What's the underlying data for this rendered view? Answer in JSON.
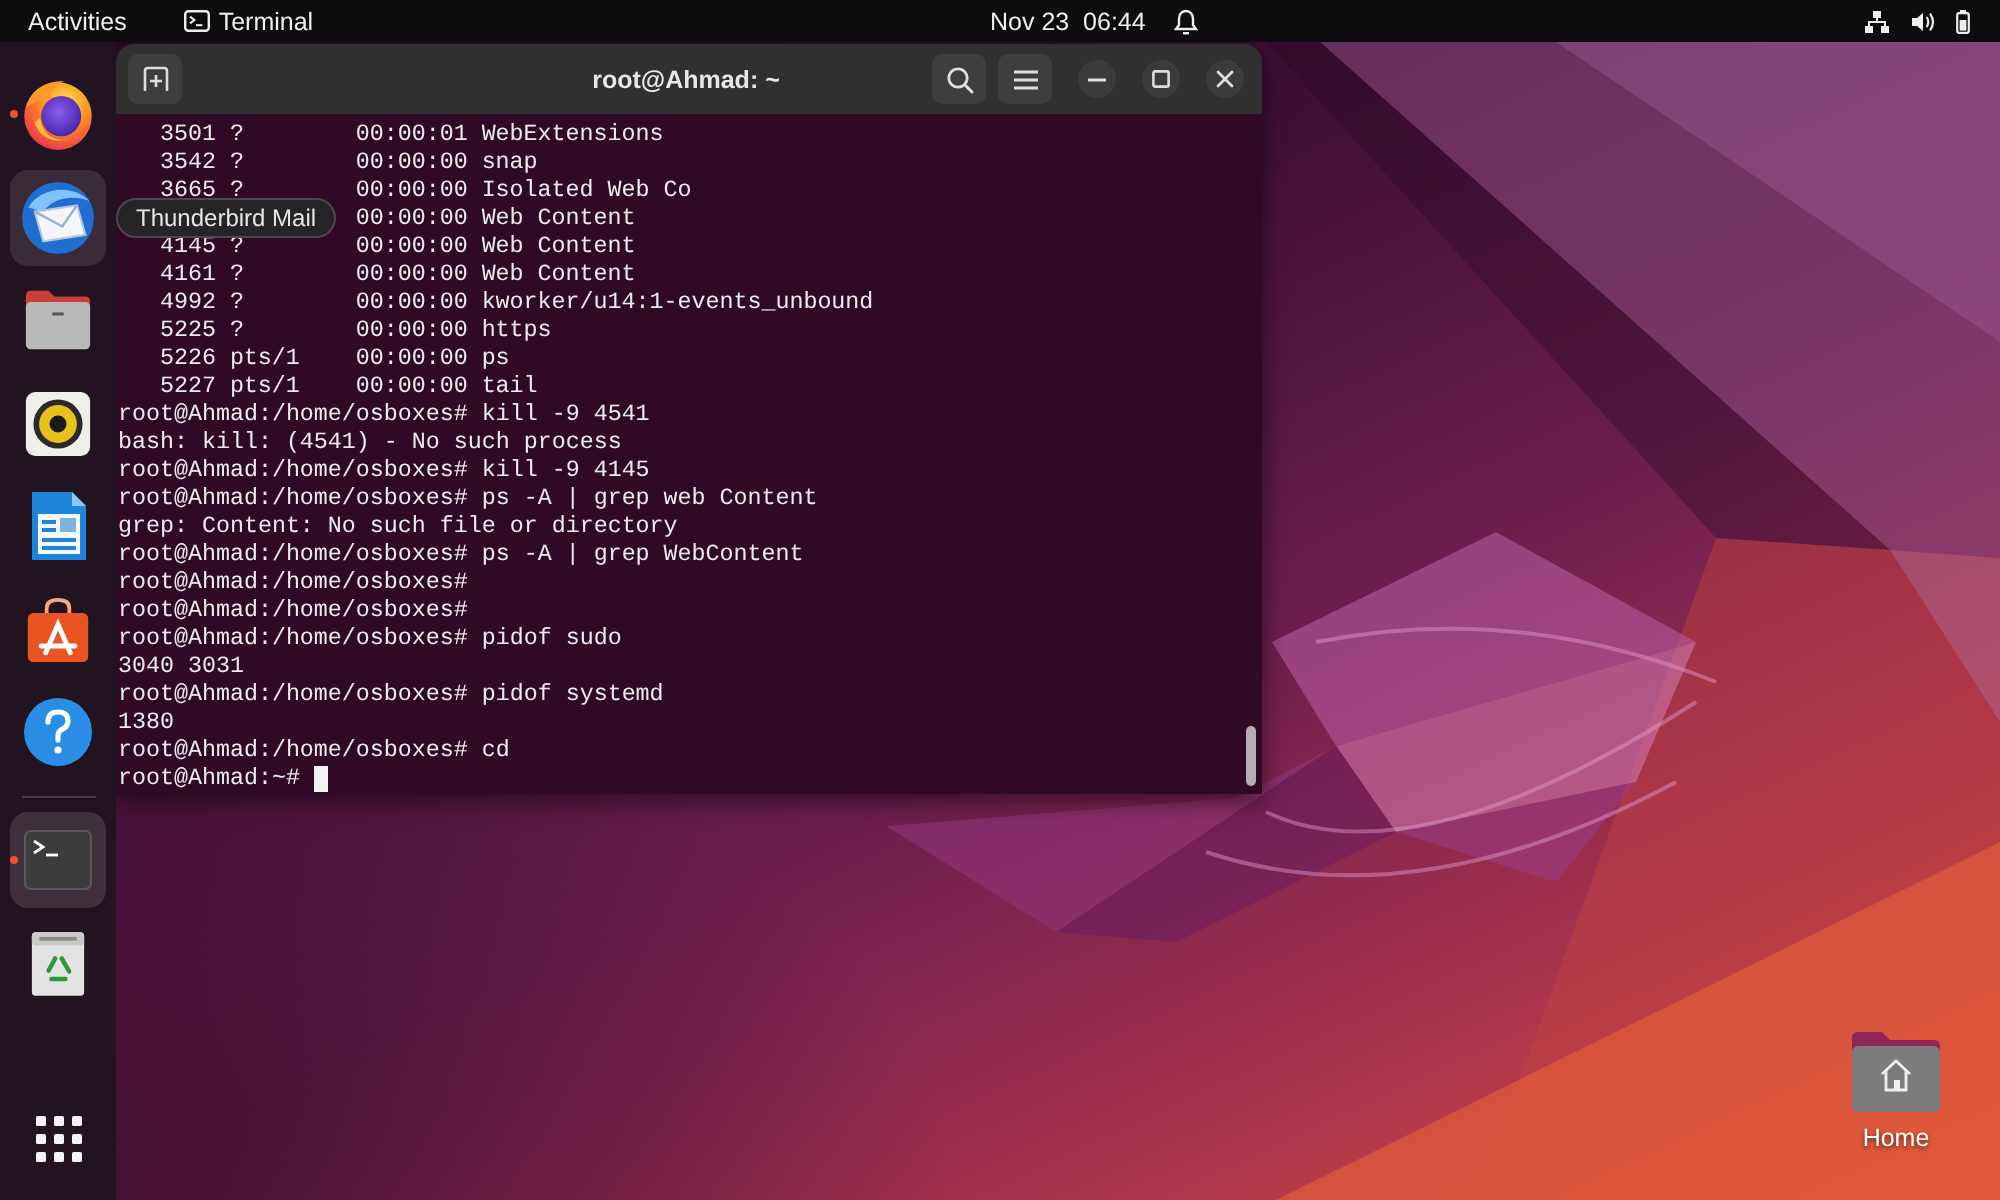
{
  "top_bar": {
    "activities": "Activities",
    "app_menu": "Terminal",
    "clock": "Nov 23  06:44"
  },
  "dock": {
    "favorites": [
      {
        "kind": "browser",
        "running": true,
        "hovered": false,
        "selected": false
      },
      {
        "kind": "mail",
        "running": false,
        "hovered": true,
        "selected": false
      },
      {
        "kind": "files",
        "running": false,
        "hovered": false,
        "selected": false
      },
      {
        "kind": "music",
        "running": false,
        "hovered": false,
        "selected": false
      },
      {
        "kind": "writer",
        "running": false,
        "hovered": false,
        "selected": false
      },
      {
        "kind": "store",
        "running": false,
        "hovered": false,
        "selected": false
      },
      {
        "kind": "help",
        "running": false,
        "hovered": false,
        "selected": false
      }
    ],
    "other_items": [
      {
        "kind": "terminal",
        "running": true,
        "hovered": false,
        "selected": true
      },
      {
        "kind": "trash",
        "running": false,
        "hovered": false,
        "selected": false
      }
    ],
    "tooltip": "Thunderbird Mail"
  },
  "terminal": {
    "title": "root@Ahmad: ~",
    "lines": [
      {
        "kind": "process",
        "pid": "3501",
        "tty": "?",
        "time": "00:00:01",
        "command": "WebExtensions"
      },
      {
        "kind": "process",
        "pid": "3542",
        "tty": "?",
        "time": "00:00:00",
        "command": "snap"
      },
      {
        "kind": "process",
        "pid": "3665",
        "tty": "?",
        "time": "00:00:00",
        "command": "Isolated Web Co"
      },
      {
        "kind": "process",
        "time": "00:00:00",
        "command": "Web Content"
      },
      {
        "kind": "process",
        "pid": "4145",
        "tty": "?",
        "time": "00:00:00",
        "command": "Web Content"
      },
      {
        "kind": "process",
        "pid": "4161",
        "tty": "?",
        "time": "00:00:00",
        "command": "Web Content"
      },
      {
        "kind": "process",
        "pid": "4992",
        "tty": "?",
        "time": "00:00:00",
        "command": "kworker/u14:1-events_unbound"
      },
      {
        "kind": "process",
        "pid": "5225",
        "tty": "?",
        "time": "00:00:00",
        "command": "https"
      },
      {
        "kind": "process",
        "pid": "5226",
        "tty": "pts/1",
        "time": "00:00:00",
        "command": "ps"
      },
      {
        "kind": "process",
        "pid": "5227",
        "tty": "pts/1",
        "time": "00:00:00",
        "command": "tail"
      },
      {
        "kind": "text",
        "text": "root@Ahmad:/home/osboxes# kill -9 4541"
      },
      {
        "kind": "text",
        "text": "bash: kill: (4541) - No such process"
      },
      {
        "kind": "text",
        "text": "root@Ahmad:/home/osboxes# kill -9 4145"
      },
      {
        "kind": "text",
        "text": "root@Ahmad:/home/osboxes# ps -A | grep web Content"
      },
      {
        "kind": "text",
        "text": "grep: Content: No such file or directory"
      },
      {
        "kind": "text",
        "text": "root@Ahmad:/home/osboxes# ps -A | grep WebContent"
      },
      {
        "kind": "text",
        "text": "root@Ahmad:/home/osboxes#"
      },
      {
        "kind": "text",
        "text": "root@Ahmad:/home/osboxes#"
      },
      {
        "kind": "text",
        "text": "root@Ahmad:/home/osboxes# pidof sudo"
      },
      {
        "kind": "text",
        "text": "3040 3031"
      },
      {
        "kind": "text",
        "text": "root@Ahmad:/home/osboxes# pidof systemd"
      },
      {
        "kind": "text",
        "text": "1380"
      },
      {
        "kind": "text",
        "text": "root@Ahmad:/home/osboxes# cd"
      },
      {
        "kind": "text",
        "text": "root@Ahmad:~#"
      }
    ],
    "cursor": true
  },
  "desktop_icons": [
    {
      "label": "Home"
    }
  ]
}
